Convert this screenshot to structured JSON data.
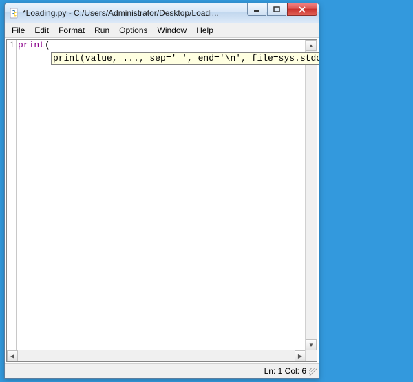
{
  "window": {
    "title": "*Loading.py - C:/Users/Administrator/Desktop/Loadi..."
  },
  "menu": {
    "items": [
      {
        "label": "File",
        "mn": "F",
        "rest": "ile"
      },
      {
        "label": "Edit",
        "mn": "E",
        "rest": "dit"
      },
      {
        "label": "Format",
        "mn": "F",
        "rest": "ormat"
      },
      {
        "label": "Run",
        "mn": "R",
        "rest": "un"
      },
      {
        "label": "Options",
        "mn": "O",
        "rest": "ptions"
      },
      {
        "label": "Window",
        "mn": "W",
        "rest": "indow"
      },
      {
        "label": "Help",
        "mn": "H",
        "rest": "elp"
      }
    ]
  },
  "editor": {
    "line_numbers": [
      "1"
    ],
    "code_builtin": "print",
    "code_after": "(",
    "calltip": "print(value, ..., sep=' ', end='\\n', file=sys.stdout, flush=False)"
  },
  "status": {
    "text": "Ln: 1  Col: 6"
  }
}
